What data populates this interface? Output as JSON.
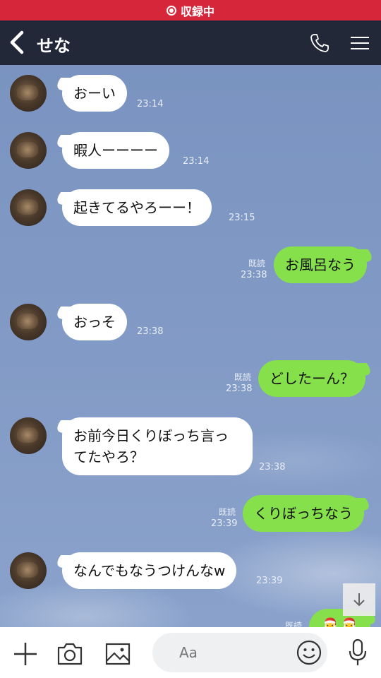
{
  "recording": {
    "label": "収録中"
  },
  "header": {
    "title": "せな"
  },
  "messages": [
    {
      "side": "in",
      "text": "おーい",
      "time": "23:14"
    },
    {
      "side": "in",
      "text": "暇人ーーーー",
      "time": "23:14"
    },
    {
      "side": "in",
      "text": "起きてるやろーー！",
      "time": "23:15"
    },
    {
      "side": "out",
      "text": "お風呂なう",
      "read": "既読",
      "time": "23:38"
    },
    {
      "side": "in",
      "text": "おっそ",
      "time": "23:38"
    },
    {
      "side": "out",
      "text": "どしたーん？",
      "read": "既読",
      "time": "23:38"
    },
    {
      "side": "in",
      "text": "お前今日くりぼっち言ってたやろ？",
      "time": "23:38"
    },
    {
      "side": "out",
      "text": "くりぼっちなう",
      "read": "既読",
      "time": "23:39"
    },
    {
      "side": "in",
      "text": "なんでもなうつけんなw",
      "time": "23:39"
    },
    {
      "side": "out",
      "text": "🎅🎅",
      "read": "既読",
      "time": ""
    }
  ],
  "composer": {
    "placeholder": "Aa"
  },
  "colors": {
    "accent_red": "#d6263a",
    "header_bg": "#222838",
    "out_bubble": "#86e04c"
  }
}
